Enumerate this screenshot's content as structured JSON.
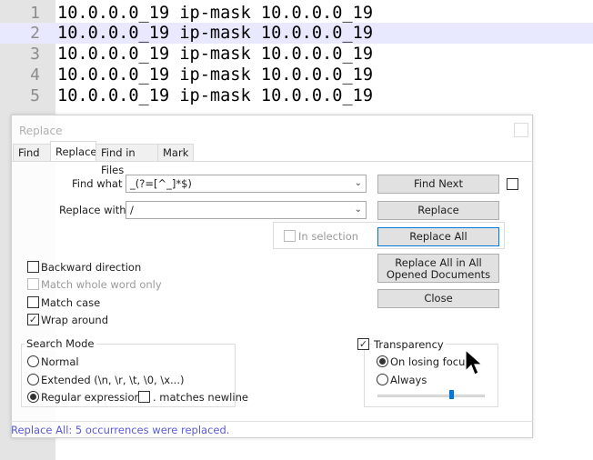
{
  "editor": {
    "lines": [
      {
        "num": "1",
        "text": "10.0.0.0_19 ip-mask 10.0.0.0_19"
      },
      {
        "num": "2",
        "text": "10.0.0.0_19 ip-mask 10.0.0.0_19"
      },
      {
        "num": "3",
        "text": "10.0.0.0_19 ip-mask 10.0.0.0_19"
      },
      {
        "num": "4",
        "text": "10.0.0.0_19 ip-mask 10.0.0.0_19"
      },
      {
        "num": "5",
        "text": "10.0.0.0_19 ip-mask 10.0.0.0_19"
      }
    ],
    "current_line_color": "#e8e8ff"
  },
  "dialog": {
    "title": "Replace",
    "tabs": [
      {
        "label": "Find"
      },
      {
        "label": "Replace"
      },
      {
        "label": "Find in Files"
      },
      {
        "label": "Mark"
      }
    ],
    "find_what": {
      "label": "Find what :",
      "value": "_(?=[^_]*$)"
    },
    "replace_with": {
      "label": "Replace with :",
      "value": "/"
    },
    "buttons": {
      "find_next": "Find Next",
      "replace": "Replace",
      "replace_all": "Replace All",
      "replace_all_opened": "Replace All in All Opened Documents",
      "close": "Close"
    },
    "in_selection": {
      "label": "In selection",
      "checked": false
    },
    "options": {
      "backward": {
        "label": "Backward direction",
        "checked": false
      },
      "whole_word": {
        "label": "Match whole word only",
        "checked": false
      },
      "match_case": {
        "label": "Match case",
        "checked": false
      },
      "wrap_around": {
        "label": "Wrap around",
        "checked": true
      }
    },
    "search_mode": {
      "title": "Search Mode",
      "normal": "Normal",
      "extended": "Extended (\\n, \\r, \\t, \\0, \\x...)",
      "regex": "Regular expression",
      "selected": "Regular expression",
      "matches_newline": ". matches newline"
    },
    "transparency": {
      "label": "Transparency",
      "checked": true,
      "on_losing_focus": "On losing focus",
      "always": "Always",
      "selected": "On losing focus",
      "slider_level": 0.7
    },
    "status": "Replace All: 5 occurrences were replaced.",
    "status_color": "#5a5ad8",
    "accent_color": "#0078d7"
  }
}
